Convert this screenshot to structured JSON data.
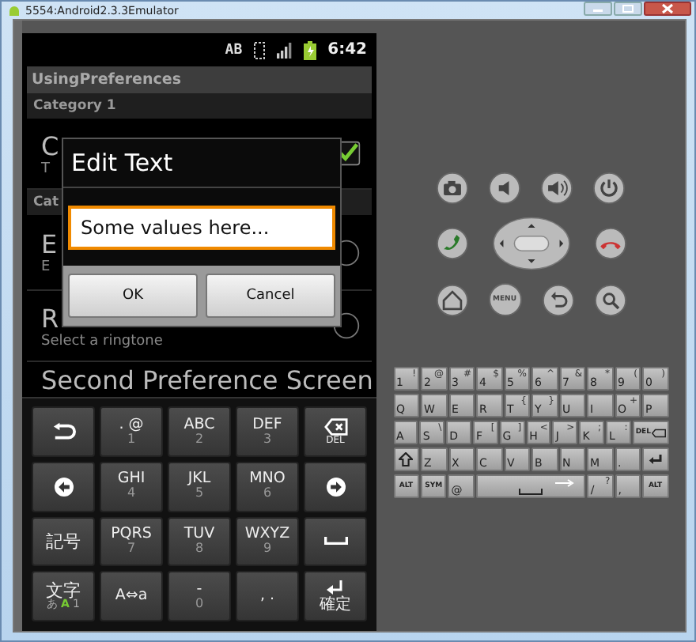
{
  "window": {
    "title": "5554:Android2.3.3Emulator"
  },
  "status_bar": {
    "input_method": "AB",
    "time": "6:42"
  },
  "app_bar": {
    "title": "UsingPreferences"
  },
  "preferences": [
    {
      "kind": "category",
      "title": "Category 1"
    },
    {
      "kind": "checkbox",
      "title": "C",
      "summary": "T",
      "checked": true
    },
    {
      "kind": "category",
      "title": "Cat"
    },
    {
      "kind": "edit",
      "title": "E",
      "summary": "E"
    },
    {
      "kind": "list",
      "title": "R",
      "summary": "Select a ringtone"
    },
    {
      "kind": "screen",
      "title": "Second Preference Screen"
    }
  ],
  "dialog": {
    "title": "Edit Text",
    "value": "Some values here...",
    "buttons": [
      "OK",
      "Cancel"
    ]
  },
  "soft_keyboard": [
    [
      {
        "kind": "undo"
      },
      {
        "kind": "text",
        "label": ". @",
        "sub": "1"
      },
      {
        "kind": "text",
        "label": "ABC",
        "sub": "2"
      },
      {
        "kind": "text",
        "label": "DEF",
        "sub": "3"
      },
      {
        "kind": "delete",
        "label": "DEL"
      }
    ],
    [
      {
        "kind": "left"
      },
      {
        "kind": "text",
        "label": "GHI",
        "sub": "4"
      },
      {
        "kind": "text",
        "label": "JKL",
        "sub": "5"
      },
      {
        "kind": "text",
        "label": "MNO",
        "sub": "6"
      },
      {
        "kind": "right"
      }
    ],
    [
      {
        "kind": "text",
        "label": "記号"
      },
      {
        "kind": "text",
        "label": "PQRS",
        "sub": "7"
      },
      {
        "kind": "text",
        "label": "TUV",
        "sub": "8"
      },
      {
        "kind": "text",
        "label": "WXYZ",
        "sub": "9"
      },
      {
        "kind": "space"
      }
    ],
    [
      {
        "kind": "mode",
        "label": "文字",
        "modes": [
          {
            "label": "あ",
            "selected": false
          },
          {
            "label": "A",
            "selected": true
          },
          {
            "label": "1",
            "selected": false
          }
        ]
      },
      {
        "kind": "text",
        "label": "A⇔a"
      },
      {
        "kind": "text",
        "label": "-",
        "sub": "0"
      },
      {
        "kind": "text",
        "label": ",  ."
      },
      {
        "kind": "enter",
        "label": "確定"
      }
    ]
  ],
  "control_buttons": [
    [
      {
        "kind": "camera"
      },
      {
        "kind": "volume_down"
      },
      {
        "kind": "volume_up"
      },
      {
        "kind": "power"
      }
    ],
    [
      {
        "kind": "call"
      },
      {
        "kind": "dpad"
      },
      {
        "kind": "end_call"
      }
    ],
    [
      {
        "kind": "home"
      },
      {
        "kind": "menu",
        "label": "MENU"
      },
      {
        "kind": "back"
      },
      {
        "kind": "search"
      }
    ]
  ],
  "hardware_keyboard": [
    [
      {
        "kind": "char",
        "label": "1",
        "alt": "!"
      },
      {
        "kind": "char",
        "label": "2",
        "alt": "@"
      },
      {
        "kind": "char",
        "label": "3",
        "alt": "#"
      },
      {
        "kind": "char",
        "label": "4",
        "alt": "$"
      },
      {
        "kind": "char",
        "label": "5",
        "alt": "%"
      },
      {
        "kind": "char",
        "label": "6",
        "alt": "^"
      },
      {
        "kind": "char",
        "label": "7",
        "alt": "&"
      },
      {
        "kind": "char",
        "label": "8",
        "alt": "*"
      },
      {
        "kind": "char",
        "label": "9",
        "alt": "("
      },
      {
        "kind": "char",
        "label": "0",
        "alt": ")"
      }
    ],
    [
      {
        "kind": "char",
        "label": "Q"
      },
      {
        "kind": "char",
        "label": "W"
      },
      {
        "kind": "char",
        "label": "E"
      },
      {
        "kind": "char",
        "label": "R"
      },
      {
        "kind": "char",
        "label": "T",
        "alt": "{"
      },
      {
        "kind": "char",
        "label": "Y",
        "alt": "}"
      },
      {
        "kind": "char",
        "label": "U"
      },
      {
        "kind": "char",
        "label": "I"
      },
      {
        "kind": "char",
        "label": "O",
        "alt": "+"
      },
      {
        "kind": "char",
        "label": "P"
      }
    ],
    [
      {
        "kind": "char",
        "label": "A"
      },
      {
        "kind": "char",
        "label": "S",
        "alt": "\\"
      },
      {
        "kind": "char",
        "label": "D"
      },
      {
        "kind": "char",
        "label": "F",
        "alt": "["
      },
      {
        "kind": "char",
        "label": "G",
        "alt": "]"
      },
      {
        "kind": "char",
        "label": "H",
        "alt": "<"
      },
      {
        "kind": "char",
        "label": "J",
        "alt": ">"
      },
      {
        "kind": "char",
        "label": "K",
        "alt": ";"
      },
      {
        "kind": "char",
        "label": "L",
        "alt": ":"
      },
      {
        "kind": "delete",
        "label": "DEL"
      }
    ],
    [
      {
        "kind": "shift"
      },
      {
        "kind": "char",
        "label": "Z"
      },
      {
        "kind": "char",
        "label": "X"
      },
      {
        "kind": "char",
        "label": "C"
      },
      {
        "kind": "char",
        "label": "V"
      },
      {
        "kind": "char",
        "label": "B"
      },
      {
        "kind": "char",
        "label": "N"
      },
      {
        "kind": "char",
        "label": "M"
      },
      {
        "kind": "char",
        "label": "."
      },
      {
        "kind": "enter"
      }
    ],
    [
      {
        "kind": "mod",
        "label": "ALT"
      },
      {
        "kind": "mod",
        "label": "SYM"
      },
      {
        "kind": "char",
        "label": "@"
      },
      {
        "kind": "space"
      },
      {
        "kind": "char",
        "label": "/",
        "alt": "?"
      },
      {
        "kind": "char",
        "label": ","
      },
      {
        "kind": "mod",
        "label": "ALT"
      }
    ]
  ]
}
